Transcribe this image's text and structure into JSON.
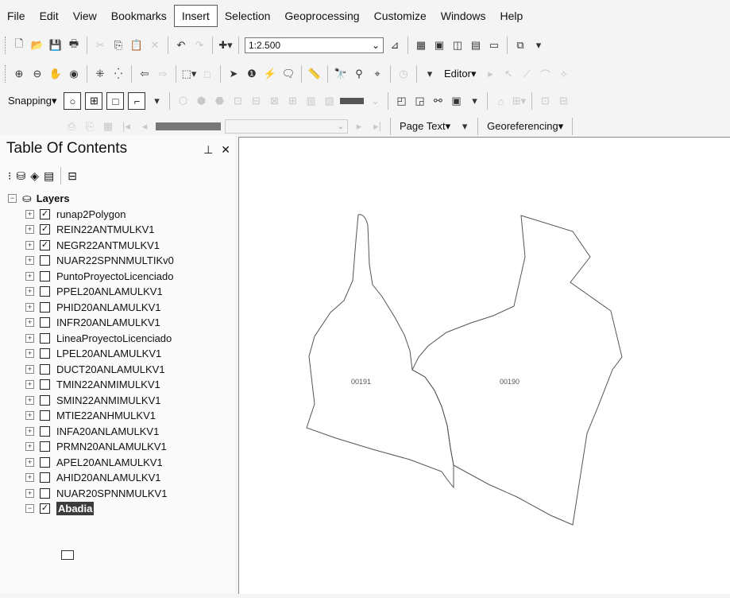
{
  "menu": [
    "File",
    "Edit",
    "View",
    "Bookmarks",
    "Insert",
    "Selection",
    "Geoprocessing",
    "Customize",
    "Windows",
    "Help"
  ],
  "active_menu_index": 4,
  "toolbar": {
    "scale_value": "1:2.500",
    "editor_label": "Editor",
    "snapping_label": "Snapping",
    "page_text_label": "Page Text",
    "georeferencing_label": "Georeferencing"
  },
  "toc": {
    "title": "Table Of Contents",
    "group_label": "Layers",
    "layers": [
      {
        "name": "runap2Polygon",
        "checked": true
      },
      {
        "name": "REIN22ANTMULKV1",
        "checked": true
      },
      {
        "name": "NEGR22ANTMULKV1",
        "checked": true
      },
      {
        "name": "NUAR22SPNNMULTIKv0",
        "checked": false
      },
      {
        "name": "PuntoProyectoLicenciado",
        "checked": false
      },
      {
        "name": "PPEL20ANLAMULKV1",
        "checked": false
      },
      {
        "name": "PHID20ANLAMULKV1",
        "checked": false
      },
      {
        "name": "INFR20ANLAMULKV1",
        "checked": false
      },
      {
        "name": "LineaProyectoLicenciado",
        "checked": false
      },
      {
        "name": "LPEL20ANLAMULKV1",
        "checked": false
      },
      {
        "name": "DUCT20ANLAMULKV1",
        "checked": false
      },
      {
        "name": "TMIN22ANMIMULKV1",
        "checked": false
      },
      {
        "name": "SMIN22ANMIMULKV1",
        "checked": false
      },
      {
        "name": "MTIE22ANHMULKV1",
        "checked": false
      },
      {
        "name": "INFA20ANLAMULKV1",
        "checked": false
      },
      {
        "name": "PRMN20ANLAMULKV1",
        "checked": false
      },
      {
        "name": "APEL20ANLAMULKV1",
        "checked": false
      },
      {
        "name": "AHID20ANLAMULKV1",
        "checked": false
      },
      {
        "name": "NUAR20SPNNMULKV1",
        "checked": false
      },
      {
        "name": "Abadia",
        "checked": true,
        "selected": true,
        "expanded": true
      }
    ]
  },
  "map": {
    "parcel_left_label": "00191",
    "parcel_right_label": "00190"
  }
}
